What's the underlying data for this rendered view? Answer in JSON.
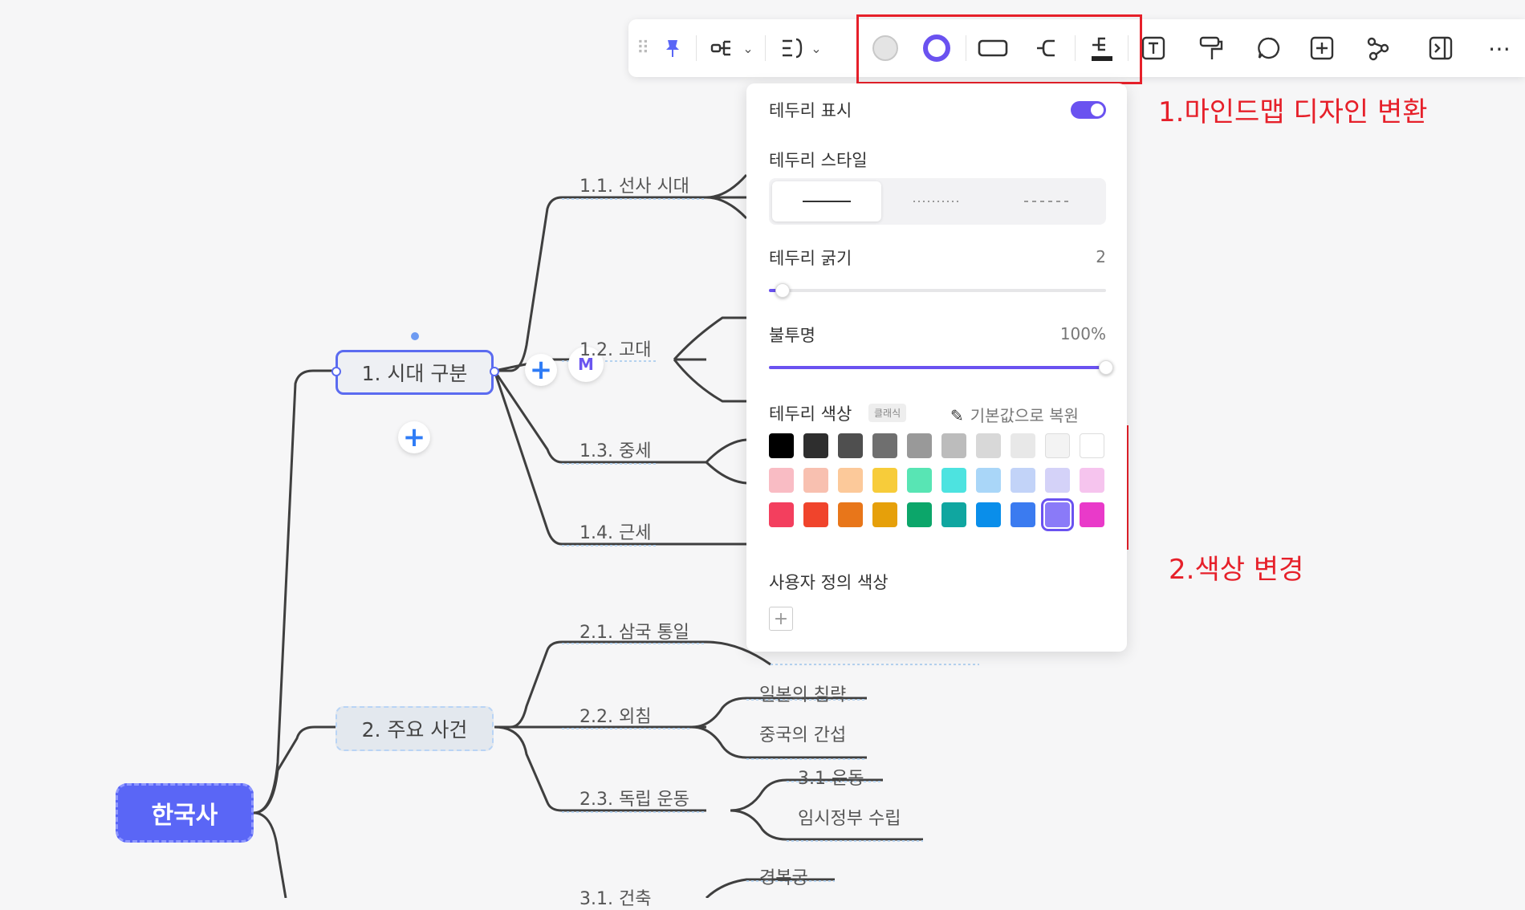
{
  "mindmap": {
    "root": "한국사",
    "branch1": {
      "label": "1. 시대 구분",
      "children": [
        "1.1. 선사 시대",
        "1.2. 고대",
        "1.3. 중세",
        "1.4. 근세"
      ]
    },
    "branch2": {
      "label": "2. 주요 사건",
      "children": [
        "2.1. 삼국 통일",
        "2.2. 외침",
        "2.3. 독립 운동"
      ],
      "grandchildren_22": [
        "일본의 침략",
        "중국의 간섭"
      ],
      "grandchildren_23": [
        "3.1 운동",
        "임시정부 수립"
      ]
    },
    "branch3": {
      "child": "3.1. 건축",
      "grandchild": "경복궁"
    },
    "plus": "+"
  },
  "panel": {
    "show_border": "테두리 표시",
    "border_style": "테두리 스타일",
    "border_width": "테두리 굵기",
    "border_width_value": "2",
    "opacity": "불투명",
    "opacity_value": "100%",
    "border_color": "테두리 색상",
    "classic_badge": "클래식",
    "restore_default": "기본값으로 복원",
    "custom_color": "사용자 정의 색상",
    "add": "+",
    "slider_width_fraction": 0.04,
    "slider_opacity_fraction": 1.0,
    "swatches": [
      [
        "#000000",
        "#2e2e2e",
        "#4f4f4f",
        "#6f6f6f",
        "#999999",
        "#bcbcbc",
        "#d8d8d8",
        "#e8e8e8",
        "#f3f3f3",
        "#ffffff"
      ],
      [
        "#f9bcc4",
        "#f8c0b0",
        "#fcc99a",
        "#f7cc3a",
        "#58e5b4",
        "#4de3e0",
        "#a9d6f8",
        "#c2d3f8",
        "#d4d2f8",
        "#f6c4ee"
      ],
      [
        "#f33f5e",
        "#f0442c",
        "#e8761a",
        "#e6a00a",
        "#0ca66a",
        "#10a6a0",
        "#0a8eea",
        "#3b7bf0",
        "#8a7af8",
        "#e93ac9"
      ]
    ],
    "selected_swatch": "2-8"
  },
  "annotations": {
    "a1": "1.마인드맵 디자인 변환",
    "a2": "2.색상 변경"
  },
  "colors": {
    "accent": "#6a52f0",
    "annotation_red": "#e6202a",
    "root_fill": "#5a66f6"
  }
}
